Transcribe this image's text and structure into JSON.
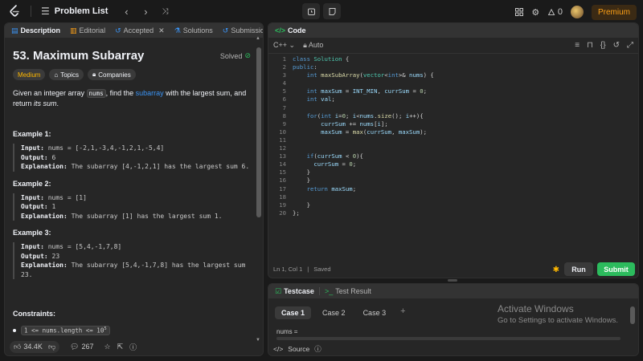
{
  "topbar": {
    "problem_list_label": "Problem List",
    "fire_count": "0",
    "premium_label": "Premium",
    "icons": [
      "leetcode-logo",
      "list-icon",
      "chevron-left-icon",
      "chevron-right-icon",
      "shuffle-icon",
      "timer-icon",
      "notes-icon",
      "grid-icon",
      "gear-icon",
      "fire-icon"
    ]
  },
  "description": {
    "tabs": [
      {
        "label": "Description",
        "active": true
      },
      {
        "label": "Editorial"
      },
      {
        "label": "Accepted"
      },
      {
        "label": "Solutions"
      },
      {
        "label": "Submission"
      }
    ],
    "title": "53. Maximum Subarray",
    "solved_label": "Solved",
    "tags": {
      "difficulty": "Medium",
      "topics": "Topics",
      "companies": "Companies"
    },
    "statement": {
      "part1": "Given an integer array ",
      "code": "nums",
      "part2": ", find the ",
      "link": "subarray",
      "part3": " with the largest sum, and return ",
      "em": "its sum",
      "part4": "."
    },
    "examples": [
      {
        "heading": "Example 1:",
        "input": "nums = [-2,1,-3,4,-1,2,1,-5,4]",
        "output": "6",
        "explanation": "The subarray [4,-1,2,1] has the largest sum 6.",
        "explanation_cont": ""
      },
      {
        "heading": "Example 2:",
        "input": "nums = [1]",
        "output": "1",
        "explanation": "The subarray [1] has the largest sum 1.",
        "explanation_cont": ""
      },
      {
        "heading": "Example 3:",
        "input": "nums = [5,4,-1,7,8]",
        "output": "23",
        "explanation": "The subarray [5,4,-1,7,8] has the largest sum",
        "explanation_cont": "23."
      }
    ],
    "labels": {
      "input": "Input:",
      "output": "Output:",
      "explanation": "Explanation:"
    },
    "constraints_heading": "Constraints:",
    "constraint1": "1 <= nums.length <= 10",
    "constraint1_sup": "5",
    "footer": {
      "likes": "34.4K",
      "comments": "267"
    }
  },
  "code": {
    "tab_label": "Code",
    "language": "C++",
    "mode": "Auto",
    "lines": [
      "class Solution {",
      "public:",
      "    int maxSubArray(vector<int>& nums) {",
      "",
      "    int maxSum = INT_MIN, currSum = 0;",
      "    int val;",
      "",
      "    for(int i=0; i<nums.size(); i++){",
      "        currSum += nums[i];",
      "        maxSum = max(currSum, maxSum);",
      "",
      "",
      "    if(currSum < 0){",
      "      currSum = 0;",
      "    }",
      "    }",
      "    return maxSum;",
      "",
      "    }",
      "};"
    ],
    "status_position": "Ln 1, Col 1",
    "status_saved": "Saved",
    "run_label": "Run",
    "submit_label": "Submit"
  },
  "test": {
    "tab_testcase": "Testcase",
    "tab_result": "Test Result",
    "cases": [
      "Case 1",
      "Case 2",
      "Case 3"
    ],
    "add_label": "+",
    "nums_label": "nums =",
    "source_label": "Source"
  },
  "watermark": {
    "line1": "Activate Windows",
    "line2": "Go to Settings to activate Windows."
  },
  "colors": {
    "accent_green": "#2cbb5d",
    "medium": "#ffb800",
    "premium": "#ffa116",
    "link": "#3b94f5"
  }
}
